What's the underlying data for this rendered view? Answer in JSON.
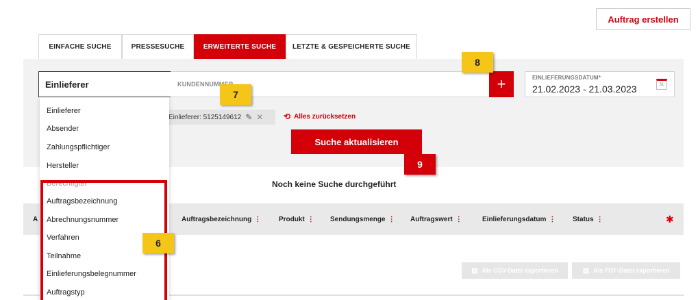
{
  "header": {
    "create_order_label": "Auftrag erstellen"
  },
  "tabs": [
    {
      "label": "EINFACHE SUCHE"
    },
    {
      "label": "PRESSESUCHE"
    },
    {
      "label": "ERWEITERTE SUCHE",
      "active": true
    },
    {
      "label": "LETZTE & GESPEICHERTE SUCHE"
    }
  ],
  "search": {
    "field_selected": "Einlieferer",
    "input_placeholder": "KUNDENNUMMER",
    "add_button": "+",
    "date_label": "EINLIEFERUNGSDATUM*",
    "date_value": "21.02.2023  -  21.03.2023",
    "calendar_day": "31"
  },
  "filter": {
    "chip_label": "Einlieferer: 5125149612",
    "reset_label": "Alles zurücksetzen",
    "update_button": "Suche aktualisieren"
  },
  "results": {
    "empty_text": "Noch keine Suche durchgeführt"
  },
  "table": {
    "columns": [
      "A",
      "Auftragsbezeichnung",
      "Produkt",
      "Sendungsmenge",
      "Auftragswert",
      "Einlieferungsdatum",
      "Status"
    ],
    "sort_glyph": "⋮"
  },
  "export": {
    "csv_label": "Als CSV-Datei exportieren",
    "pdf_label": "Als PDF-Datei exportieren"
  },
  "dropdown": {
    "items": [
      "Einlieferer",
      "Absender",
      "Zahlungspflichtiger",
      "Hersteller",
      "Berechtigter",
      "Auftragsbezeichnung",
      "Abrechnungsnummer",
      "Verfahren",
      "Teilnahme",
      "Einlieferungsbelegnummer",
      "Auftragstyp"
    ]
  },
  "annotations": {
    "b6": "6",
    "b7": "7",
    "b8": "8",
    "b9": "9"
  },
  "colors": {
    "accent": "#d3000a",
    "badge_yellow": "#f5c518",
    "panel": "#f2f2f2"
  }
}
